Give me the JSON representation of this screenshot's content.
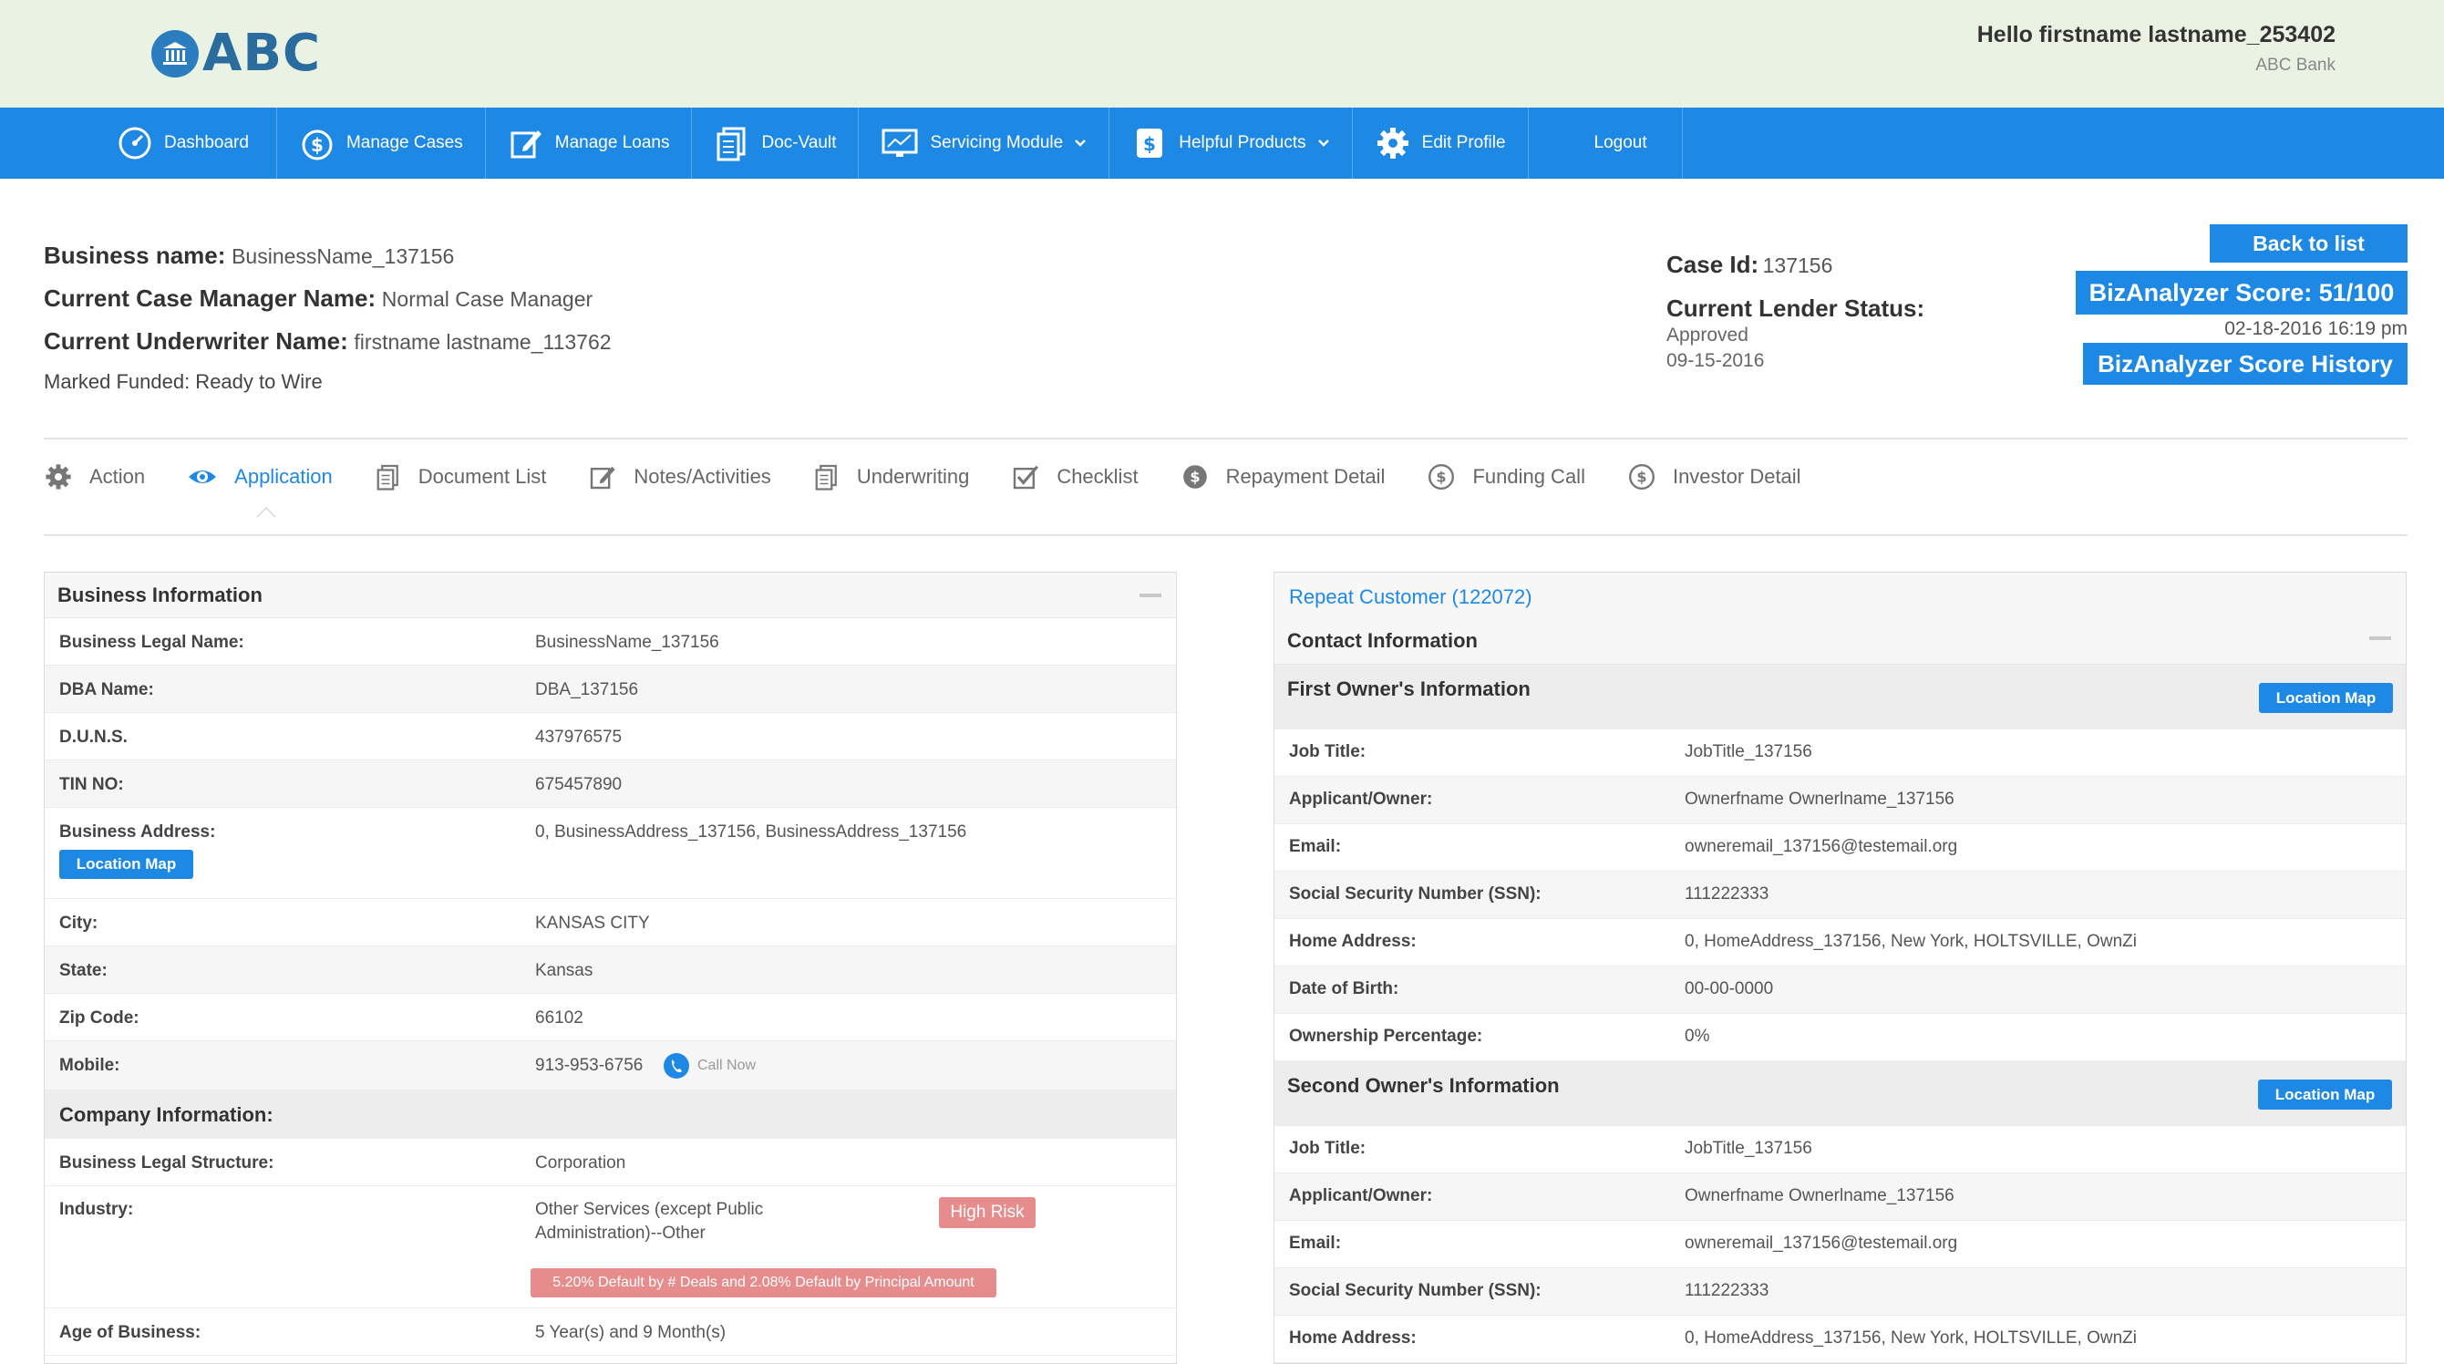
{
  "header": {
    "logo_text": "ABC",
    "greeting": "Hello firstname lastname_253402",
    "bank": "ABC Bank"
  },
  "nav": [
    {
      "label": "Dashboard",
      "icon": "dashboard-icon"
    },
    {
      "label": "Manage Cases",
      "icon": "dollar-icon"
    },
    {
      "label": "Manage Loans",
      "icon": "edit-icon"
    },
    {
      "label": "Doc-Vault",
      "icon": "documents-icon"
    },
    {
      "label": "Servicing Module",
      "icon": "monitor-icon"
    },
    {
      "label": "Helpful Products",
      "icon": "dollar-doc-icon"
    },
    {
      "label": "Edit Profile",
      "icon": "gear-icon"
    },
    {
      "label": "Logout",
      "icon": ""
    }
  ],
  "case": {
    "business_name_label": "Business name:",
    "business_name": "BusinessName_137156",
    "manager_label": "Current Case Manager Name:",
    "manager": "Normal Case Manager",
    "underwriter_label": "Current Underwriter Name:",
    "underwriter": "firstname lastname_113762",
    "funded": "Marked Funded: Ready to Wire",
    "case_id_label": "Case Id:",
    "case_id": "137156",
    "lender_status_label": "Current Lender Status:",
    "lender_status": "Approved",
    "lender_status_date": "09-15-2016",
    "back_label": "Back to list",
    "score_label": "BizAnalyzer Score: 51/100",
    "score_date": "02-18-2016 16:19 pm",
    "history_label": "BizAnalyzer Score History"
  },
  "tabs": [
    {
      "label": "Action",
      "icon": "gear-icon"
    },
    {
      "label": "Application",
      "icon": "eye-icon"
    },
    {
      "label": "Document List",
      "icon": "documents-icon"
    },
    {
      "label": "Notes/Activities",
      "icon": "edit-icon"
    },
    {
      "label": "Underwriting",
      "icon": "documents-icon"
    },
    {
      "label": "Checklist",
      "icon": "checklist-icon"
    },
    {
      "label": "Repayment Detail",
      "icon": "money-icon"
    },
    {
      "label": "Funding Call",
      "icon": "dollar-icon"
    },
    {
      "label": "Investor Detail",
      "icon": "dollar-icon"
    }
  ],
  "business": {
    "title": "Business Information",
    "legal_name_label": "Business Legal Name:",
    "legal_name": "BusinessName_137156",
    "dba_label": "DBA Name:",
    "dba": "DBA_137156",
    "duns_label": "D.U.N.S.",
    "duns": "437976575",
    "tin_label": "TIN NO:",
    "tin": "675457890",
    "address_label": "Business Address:",
    "address": "0, BusinessAddress_137156, BusinessAddress_137156",
    "location_map": "Location Map",
    "city_label": "City:",
    "city": "KANSAS CITY",
    "state_label": "State:",
    "state": "Kansas",
    "zip_label": "Zip Code:",
    "zip": "66102",
    "mobile_label": "Mobile:",
    "mobile": "913-953-6756",
    "call_now": "Call Now",
    "company_title": "Company Information:",
    "structure_label": "Business Legal Structure:",
    "structure": "Corporation",
    "industry_label": "Industry:",
    "industry_line1": "Other Services (except Public",
    "industry_line2": "Administration)--Other",
    "risk": "High Risk",
    "default_note": "5.20% Default by # Deals and 2.08% Default by Principal Amount",
    "age_label": "Age of Business:",
    "age": "5 Year(s) and 9 Month(s)"
  },
  "contact": {
    "repeat": "Repeat Customer (122072)",
    "title": "Contact Information",
    "location_map": "Location Map",
    "owner1_title": "First Owner's Information",
    "owner2_title": "Second Owner's Information",
    "job_label": "Job Title:",
    "applicant_label": "Applicant/Owner:",
    "email_label": "Email:",
    "ssn_label": "Social Security Number (SSN):",
    "home_label": "Home Address:",
    "dob_label": "Date of Birth:",
    "ownership_label": "Ownership Percentage:",
    "owner1": {
      "job": "JobTitle_137156",
      "applicant": "Ownerfname Ownerlname_137156",
      "email": "owneremail_137156@testemail.org",
      "ssn": "111222333",
      "home": "0, HomeAddress_137156, New York, HOLTSVILLE, OwnZi",
      "dob": "00-00-0000",
      "ownership": "0%"
    },
    "owner2": {
      "job": "JobTitle_137156",
      "applicant": "Ownerfname Ownerlname_137156",
      "email": "owneremail_137156@testemail.org",
      "ssn": "111222333",
      "home": "0, HomeAddress_137156, New York, HOLTSVILLE, OwnZi"
    }
  },
  "colors": {
    "primary": "#1e88e5",
    "header_bg": "#eaf3e3",
    "risk": "#e68c8c"
  }
}
